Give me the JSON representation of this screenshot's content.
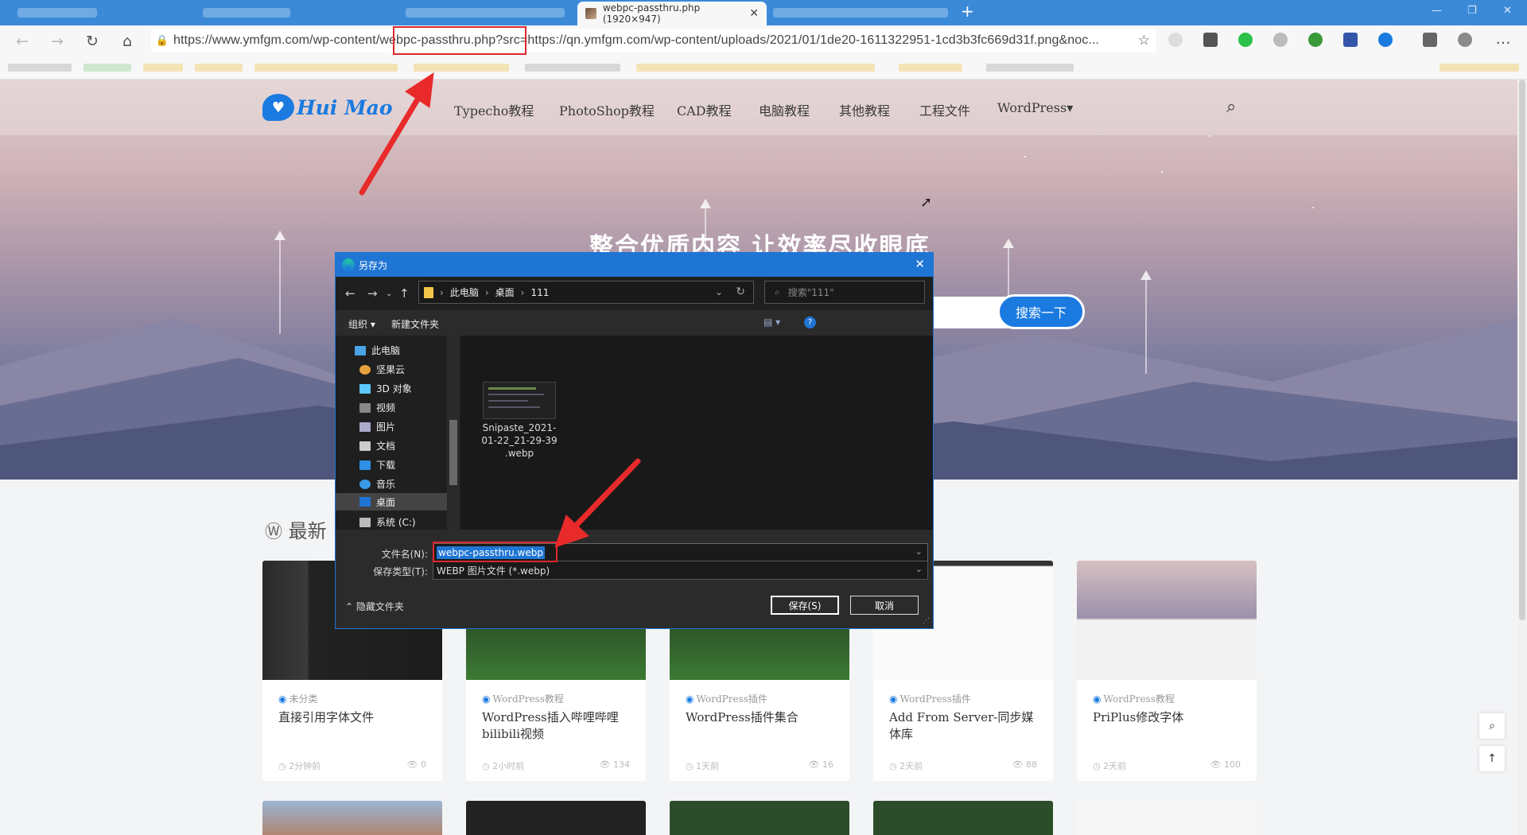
{
  "browser": {
    "active_tab_title": "webpc-passthru.php (1920×947)",
    "new_tab_glyph": "+",
    "url": "https://www.ymfgm.com/wp-content/webpc-passthru.php?src=https://qn.ymfgm.com/wp-content/uploads/2021/01/1de20-1611322951-1cd3b3fc669d31f.png&noc...",
    "url_prefix": "https://www.ymfgm.com/wp-content/",
    "url_highlight": "webpc-passthru.php?s",
    "url_suffix": "rc=https://qn.ymfgm.com/wp-content/uploads/2021/01/1de20-1611322951-1cd3b3fc669d31f.png&noc...",
    "nav_icons": [
      "back-icon",
      "forward-icon",
      "refresh-icon",
      "home-icon"
    ],
    "accent_color": "#3a8ad8"
  },
  "site": {
    "logo_text": "Hui Mao",
    "menu": [
      "Typecho教程",
      "PhotoShop教程",
      "CAD教程",
      "电脑教程",
      "其他教程",
      "工程文件",
      "WordPress▾"
    ],
    "hero_title": "整合优质内容 让效率尽收眼底",
    "search_button": "搜索一下",
    "latest_heading": "最新",
    "brand_color": "#1a7ae0",
    "cards": [
      {
        "category": "未分类",
        "title": "直接引用字体文件",
        "time": "2分钟前",
        "views": "0"
      },
      {
        "category": "WordPress教程",
        "title": "WordPress插入哔哩哔哩bilibili视频",
        "time": "2小时前",
        "views": "134"
      },
      {
        "category": "WordPress插件",
        "title": "WordPress插件集合",
        "time": "1天前",
        "views": "16"
      },
      {
        "category": "WordPress插件",
        "title": "Add From Server-同步媒体库",
        "time": "2天前",
        "views": "88"
      },
      {
        "category": "WordPress教程",
        "title": "PriPlus修改字体",
        "time": "2天前",
        "views": "100"
      }
    ]
  },
  "dialog": {
    "title": "另存为",
    "path": [
      "此电脑",
      "桌面",
      "111"
    ],
    "search_placeholder": "搜索\"111\"",
    "organize": "组织 ▾",
    "new_folder": "新建文件夹",
    "help": "?",
    "tree": [
      "此电脑",
      "坚果云",
      "3D 对象",
      "视频",
      "图片",
      "文档",
      "下载",
      "音乐",
      "桌面",
      "系统 (C:)"
    ],
    "tree_selected": "桌面",
    "file_name_line1": "Snipaste_2021-",
    "file_name_line2": "01-22_21-29-39",
    "file_name_line3": ".webp",
    "filename_label": "文件名(N):",
    "filename_value": "webpc-passthru.webp",
    "filetype_label": "保存类型(T):",
    "filetype_value": "WEBP 图片文件 (*.webp)",
    "hide_folders": "隐藏文件夹",
    "save": "保存(S)",
    "cancel": "取消",
    "accent_color": "#1f75d3"
  },
  "annotation_color": "#e0262c"
}
